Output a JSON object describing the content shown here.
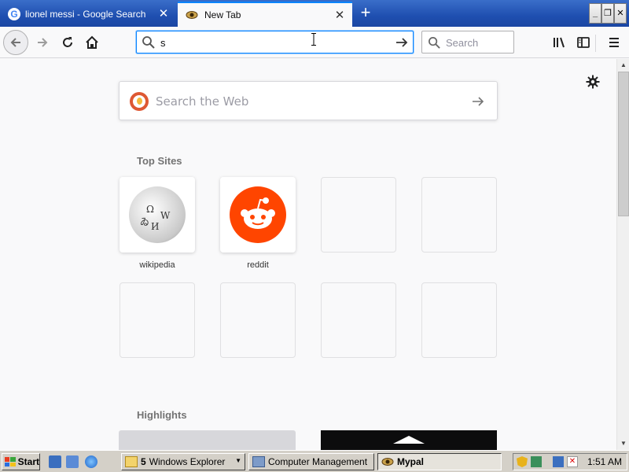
{
  "tabs": [
    {
      "title": "lionel messi - Google Search",
      "favicon": "google-g-icon",
      "active": false
    },
    {
      "title": "New Tab",
      "favicon": "mypal-eye-icon",
      "active": true
    }
  ],
  "window_controls": {
    "minimize": "_",
    "maximize": "❐",
    "close": "✕"
  },
  "toolbar": {
    "url_value": "s",
    "search_placeholder": "Search"
  },
  "newtab": {
    "web_search_placeholder": "Search the Web",
    "top_sites_title": "Top Sites",
    "highlights_title": "Highlights",
    "top_sites": [
      {
        "label": "wikipedia"
      },
      {
        "label": "reddit"
      },
      {
        "label": ""
      },
      {
        "label": ""
      },
      {
        "label": ""
      },
      {
        "label": ""
      },
      {
        "label": ""
      },
      {
        "label": ""
      }
    ]
  },
  "taskbar": {
    "start_label": "Start",
    "tasks": [
      {
        "count": "5",
        "label": "Windows Explorer"
      },
      {
        "label": "Computer Management"
      },
      {
        "label": "Mypal"
      }
    ],
    "clock": "1:51 AM"
  },
  "colors": {
    "accent": "#0a84ff",
    "reddit": "#ff4500",
    "duckduckgo": "#de5833",
    "titlebar": "#1f4fb0"
  }
}
